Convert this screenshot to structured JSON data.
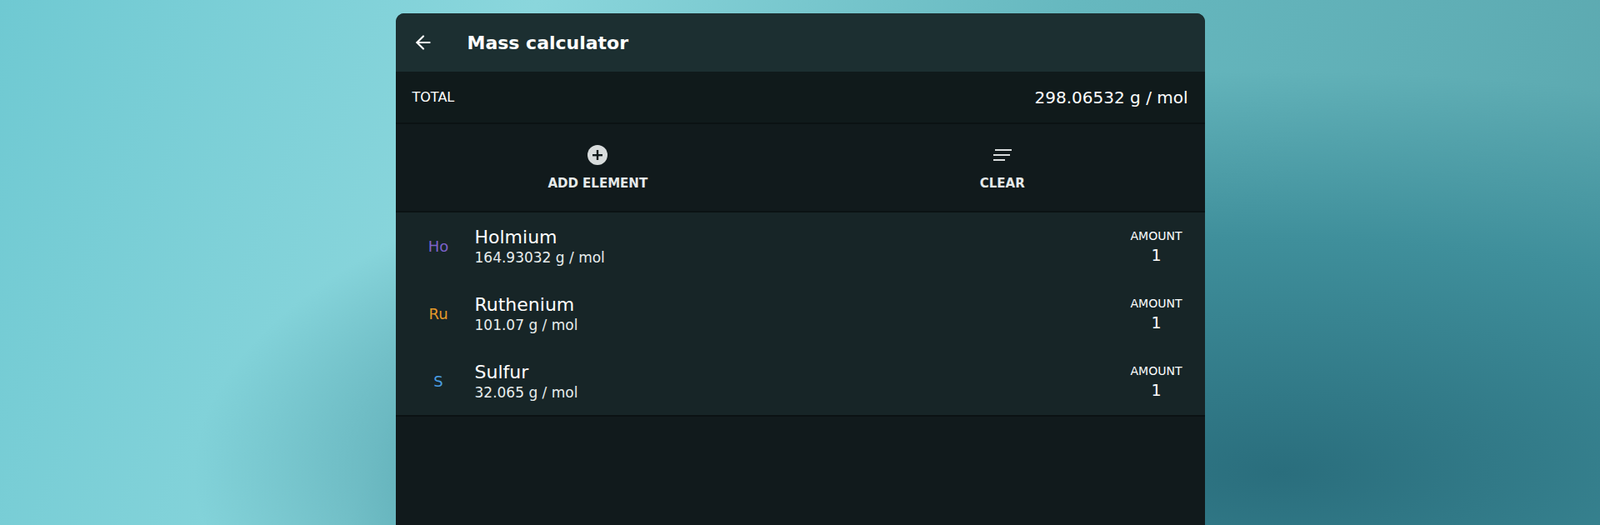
{
  "window": {
    "title": "Mass calculator"
  },
  "total": {
    "label": "TOTAL",
    "value": "298.06532 g / mol"
  },
  "actions": [
    {
      "label": "ADD ELEMENT",
      "kind": "add"
    },
    {
      "label": "CLEAR",
      "kind": "clear"
    }
  ],
  "elements": [
    {
      "symbol": "Ho",
      "name": "Holmium",
      "mass": "164.93032 g / mol",
      "amount_label": "AMOUNT",
      "amount": "1",
      "color": "#7d62c9"
    },
    {
      "symbol": "Ru",
      "name": "Ruthenium",
      "mass": "101.07 g / mol",
      "amount_label": "AMOUNT",
      "amount": "1",
      "color": "#e6992a"
    },
    {
      "symbol": "S",
      "name": "Sulfur",
      "mass": "32.065 g / mol",
      "amount_label": "AMOUNT",
      "amount": "1",
      "color": "#4a9ee2"
    }
  ]
}
